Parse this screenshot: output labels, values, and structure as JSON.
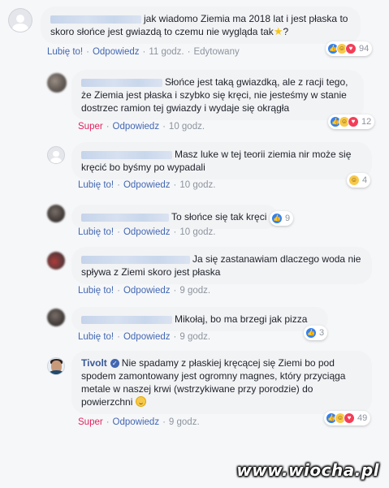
{
  "comments": [
    {
      "text": "jak wiadomo Ziemia ma 2018 lat i jest płaska to skoro słońce jest gwiazdą to czemu nie wygląda tak",
      "tail": "?",
      "emoji": "star-emoji",
      "actions": {
        "like": "Lubię to!",
        "reply": "Odpowiedz",
        "time": "11 godz.",
        "extra": "Edytowany"
      },
      "reactions": {
        "count": "94",
        "icons": [
          "like-icon",
          "haha-icon",
          "love-icon"
        ]
      }
    },
    {
      "text": "Słońce jest taką gwiazdką, ale z racji tego, że Ziemia jest płaska i szybko się kręci, nie jesteśmy w stanie dostrzec ramion tej gwiazdy i wydaje się okrągła",
      "actions": {
        "like": "Super",
        "reply": "Odpowiedz",
        "time": "10 godz."
      },
      "reactions": {
        "count": "12",
        "icons": [
          "like-icon",
          "haha-icon",
          "love-icon"
        ]
      }
    },
    {
      "text": "Masz luke w tej teorii ziemia nir może się kręcić bo byśmy po wypadali",
      "actions": {
        "like": "Lubię to!",
        "reply": "Odpowiedz",
        "time": "10 godz."
      },
      "reactions": {
        "count": "4",
        "icons": [
          "haha-icon"
        ]
      }
    },
    {
      "text": "To słońce się tak kręci",
      "actions": {
        "like": "Lubię to!",
        "reply": "Odpowiedz",
        "time": "10 godz."
      },
      "reactions": {
        "count": "9",
        "icons": [
          "like-icon"
        ]
      }
    },
    {
      "text": "Ja się zastanawiam dlaczego woda nie spływa z Ziemi skoro jest płaska",
      "actions": {
        "like": "Lubię to!",
        "reply": "Odpowiedz",
        "time": "9 godz."
      }
    },
    {
      "text": "Mikołaj, bo ma brzegi jak pizza",
      "actions": {
        "like": "Lubię to!",
        "reply": "Odpowiedz",
        "time": "9 godz."
      },
      "reactions": {
        "count": "3",
        "icons": [
          "like-icon"
        ]
      }
    },
    {
      "name": "Tivolt",
      "text": "Nie spadamy z płaskiej kręcącej się Ziemi bo pod spodem zamontowany jest ogromny magnes, który przyciąga metale w naszej krwi (wstrzykiwane przy porodzie) do powierzchni",
      "emoji": "smile-emoji",
      "actions": {
        "like": "Super",
        "reply": "Odpowiedz",
        "time": "9 godz."
      },
      "reactions": {
        "count": "49",
        "icons": [
          "like-icon",
          "haha-icon",
          "love-icon"
        ]
      }
    }
  ],
  "watermark": "www.wiocha.pl"
}
